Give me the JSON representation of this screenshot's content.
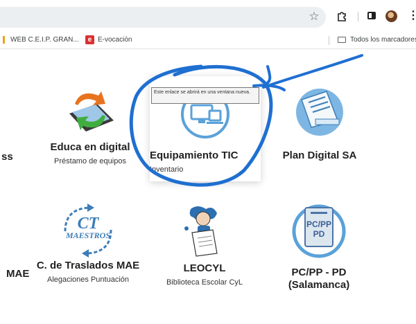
{
  "browser": {
    "bookmarks": [
      {
        "label": "WEB C.E.I.P. GRAN..."
      },
      {
        "label": "E-vocación",
        "favicon_letter": "e"
      }
    ],
    "all_bookmarks_label": "Todos los marcadores",
    "star_glyph": "☆",
    "menu_glyph": "⋮"
  },
  "tiles": {
    "partial_top": {
      "title": "ss"
    },
    "educa": {
      "title": "Educa en digital",
      "subtitle": "Préstamo de equipos"
    },
    "equipamiento": {
      "title": "Equipamiento TIC",
      "subtitle": "Inventario",
      "tooltip": "Este enlace se abrirá en una ventana nueva."
    },
    "plan": {
      "title": "Plan Digital SA"
    },
    "partial_bottom": {
      "title": "MAE"
    },
    "traslados": {
      "title": "C. de Traslados MAE",
      "subtitle": "Alegaciones Puntuación",
      "logo_text": [
        "CT",
        "MAESTROS"
      ]
    },
    "leocyl": {
      "title": "LEOCYL",
      "subtitle": "Biblioteca Escolar CyL"
    },
    "pcpp": {
      "title": "PC/PP - PD",
      "title2": "(Salamanca)",
      "logo_text": [
        "PC/PP",
        "PD"
      ]
    }
  },
  "colors": {
    "accent_blue": "#5aa2d9",
    "annotation_blue": "#1f6fd1",
    "tooltip_bg": "#f4f4f4"
  }
}
